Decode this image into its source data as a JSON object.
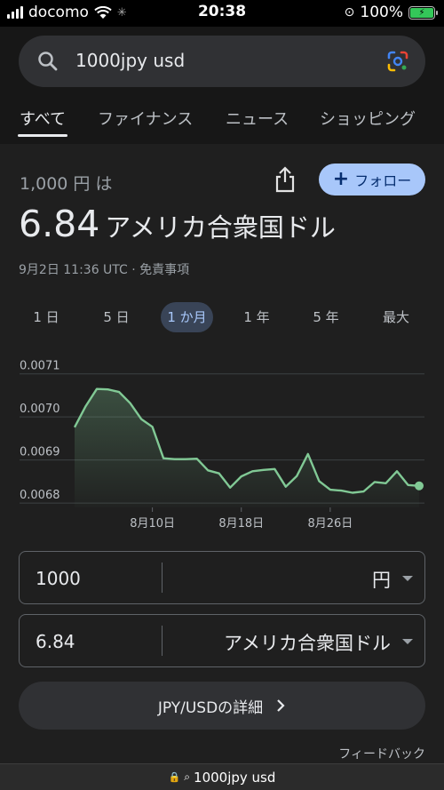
{
  "status_bar": {
    "carrier": "docomo",
    "time": "20:38",
    "battery": "100%"
  },
  "search": {
    "query": "1000jpy usd"
  },
  "tabs": [
    "すべて",
    "ファイナンス",
    "ニュース",
    "ショッピング"
  ],
  "result": {
    "from_amount": "1,000 円 は",
    "to_value": "6.84",
    "to_currency": "アメリカ合衆国ドル",
    "meta": "9月2日 11:36 UTC · 免責事項",
    "follow_label": "フォロー"
  },
  "ranges": [
    "1 日",
    "5 日",
    "1 か月",
    "1 年",
    "5 年",
    "最大"
  ],
  "chart_data": {
    "type": "area",
    "x_ticks": [
      "8月10日",
      "8月18日",
      "8月26日"
    ],
    "y_ticks": [
      "0.0071",
      "0.0070",
      "0.0069",
      "0.0068"
    ],
    "ylim": [
      0.00679,
      0.00712
    ],
    "grid": true,
    "values": [
      0.006976,
      0.007025,
      0.007065,
      0.007064,
      0.007058,
      0.007032,
      0.006995,
      0.006977,
      0.006904,
      0.006902,
      0.006902,
      0.006903,
      0.006876,
      0.006869,
      0.006836,
      0.006862,
      0.006874,
      0.006877,
      0.006879,
      0.006838,
      0.006863,
      0.006914,
      0.006851,
      0.006831,
      0.006829,
      0.006824,
      0.006827,
      0.006849,
      0.006846,
      0.006874,
      0.006842,
      0.00684
    ],
    "line_color": "#81c995"
  },
  "converter": {
    "from_value": "1000",
    "from_unit": "円",
    "to_value": "6.84",
    "to_unit": "アメリカ合衆国ドル"
  },
  "details_label": "JPY/USDの詳細",
  "feedback_label": "フィードバック",
  "url_bar": "1000jpy usd"
}
